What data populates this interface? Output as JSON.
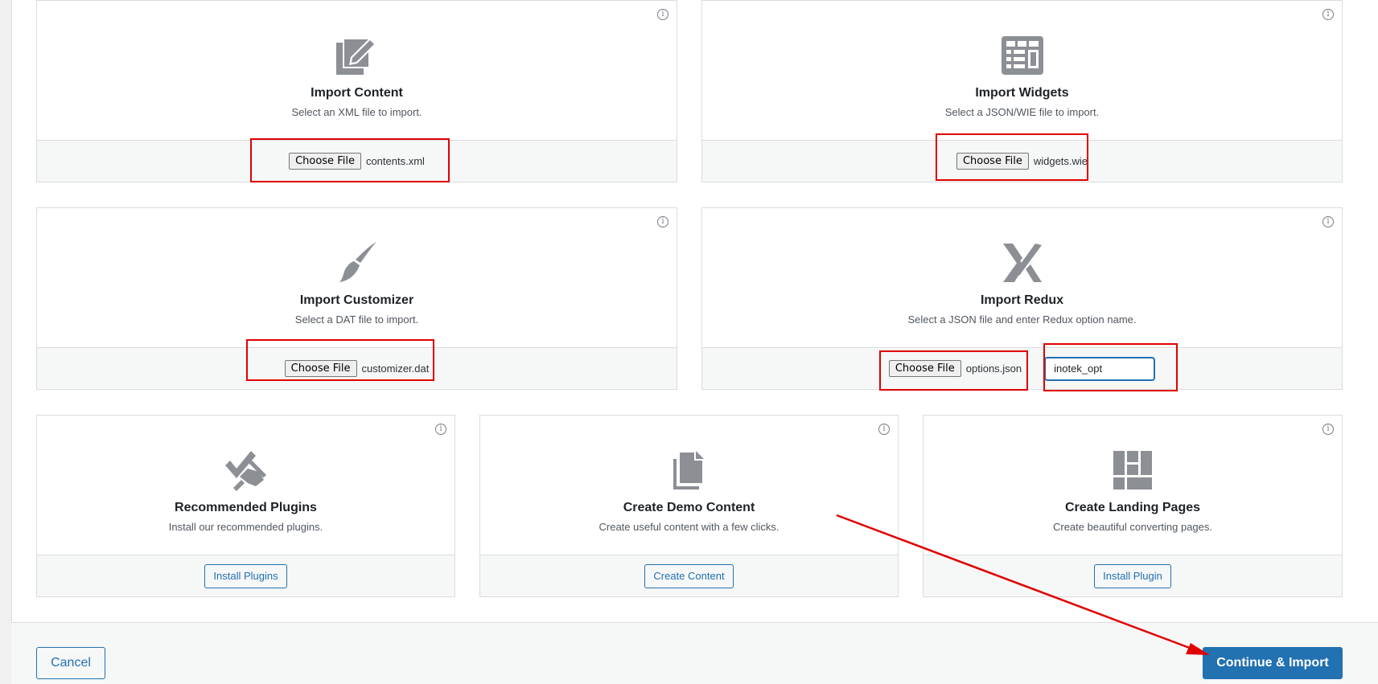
{
  "import_cards": [
    {
      "title": "Import Content",
      "description": "Select an XML file to import.",
      "button": "Choose File",
      "file": "contents.xml",
      "icon": "import-content-icon"
    },
    {
      "title": "Import Widgets",
      "description": "Select a JSON/WIE file to import.",
      "button": "Choose File",
      "file": "widgets.wie",
      "icon": "widgets-icon"
    },
    {
      "title": "Import Customizer",
      "description": "Select a DAT file to import.",
      "button": "Choose File",
      "file": "customizer.dat",
      "icon": "brush-icon"
    },
    {
      "title": "Import Redux",
      "description": "Select a JSON file and enter Redux option name.",
      "button": "Choose File",
      "file": "options.json",
      "option_value": "inotek_opt",
      "icon": "redux-icon"
    }
  ],
  "action_cards": [
    {
      "title": "Recommended Plugins",
      "description": "Install our recommended plugins.",
      "button": "Install Plugins",
      "icon": "plugin-icon"
    },
    {
      "title": "Create Demo Content",
      "description": "Create useful content with a few clicks.",
      "button": "Create Content",
      "icon": "copy-pages-icon"
    },
    {
      "title": "Create Landing Pages",
      "description": "Create beautiful converting pages.",
      "button": "Install Plugin",
      "icon": "layout-icon"
    }
  ],
  "info_glyph": "i",
  "footer": {
    "cancel": "Cancel",
    "continue": "Continue & Import"
  },
  "colors": {
    "accent": "#2271b1",
    "highlight": "#e00000",
    "icon": "#8c8f94"
  }
}
